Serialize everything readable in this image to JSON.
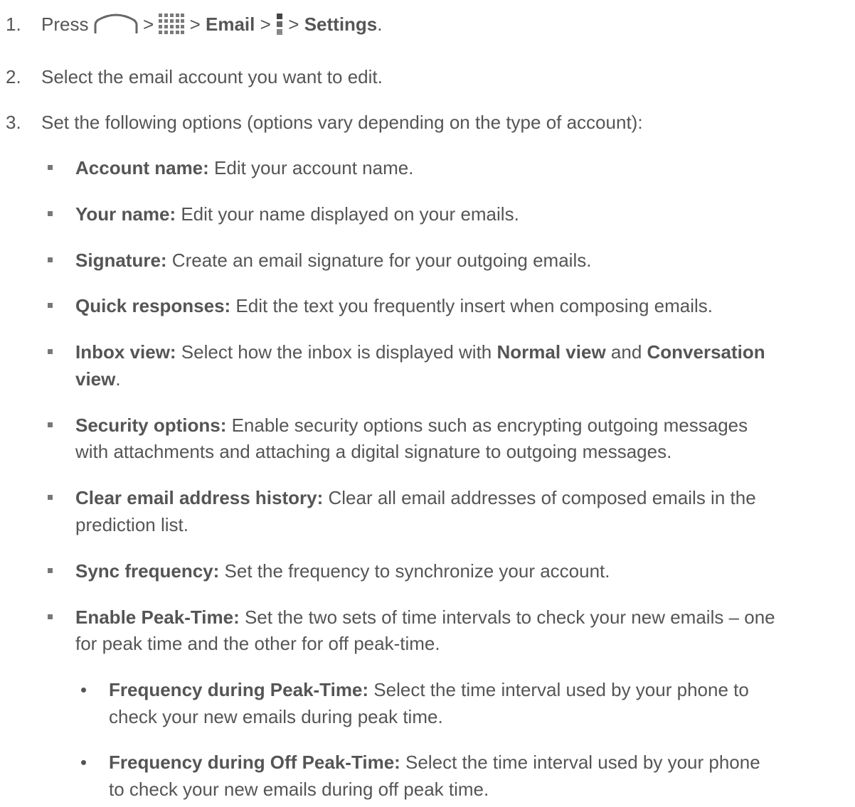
{
  "steps": [
    {
      "number": "1.",
      "parts": {
        "press": "Press",
        "sep1": ">",
        "sep2": ">",
        "email": "Email",
        "sep3": ">",
        "sep4": ">",
        "settings": "Settings",
        "end": "."
      },
      "icons": [
        "home-icon",
        "apps-grid-icon",
        "menu-icon"
      ]
    },
    {
      "number": "2.",
      "text": "Select the email account you want to edit."
    },
    {
      "number": "3.",
      "text": "Set the following options (options vary depending on the type of account):"
    }
  ],
  "options": [
    {
      "label": "Account name:",
      "lines": [
        " Edit your account name."
      ]
    },
    {
      "label": "Your name:",
      "lines": [
        " Edit your name displayed on your emails."
      ]
    },
    {
      "label": "Signature:",
      "lines": [
        " Create an email signature for your outgoing emails."
      ]
    },
    {
      "label": "Quick responses:",
      "lines": [
        " Edit the text you frequently insert when composing emails."
      ]
    },
    {
      "label": "Inbox view:",
      "pre": " Select how the inbox is displayed with ",
      "bold1": "Normal view",
      "mid": " and ",
      "bold2a": "Conversation",
      "bold2b": "view",
      "end": "."
    },
    {
      "label": "Security options:",
      "lines": [
        " Enable security options such as encrypting outgoing messages",
        "with attachments and attaching a digital signature to outgoing messages."
      ]
    },
    {
      "label": "Clear email address history:",
      "lines": [
        " Clear all email addresses of composed emails in the",
        "prediction list."
      ]
    },
    {
      "label": "Sync frequency:",
      "lines": [
        " Set the frequency to synchronize your account."
      ]
    },
    {
      "label": "Enable Peak-Time:",
      "lines": [
        " Set the two sets of time intervals to check your new emails – one",
        "for peak time and the other for off peak-time."
      ]
    }
  ],
  "sub_options": [
    {
      "label": "Frequency during Peak-Time:",
      "lines": [
        " Select the time interval used by your phone to",
        "check your new emails during peak time."
      ]
    },
    {
      "label": "Frequency during Off Peak-Time:",
      "lines": [
        " Select the time interval used by your phone",
        "to check your new emails during off peak time."
      ]
    }
  ]
}
